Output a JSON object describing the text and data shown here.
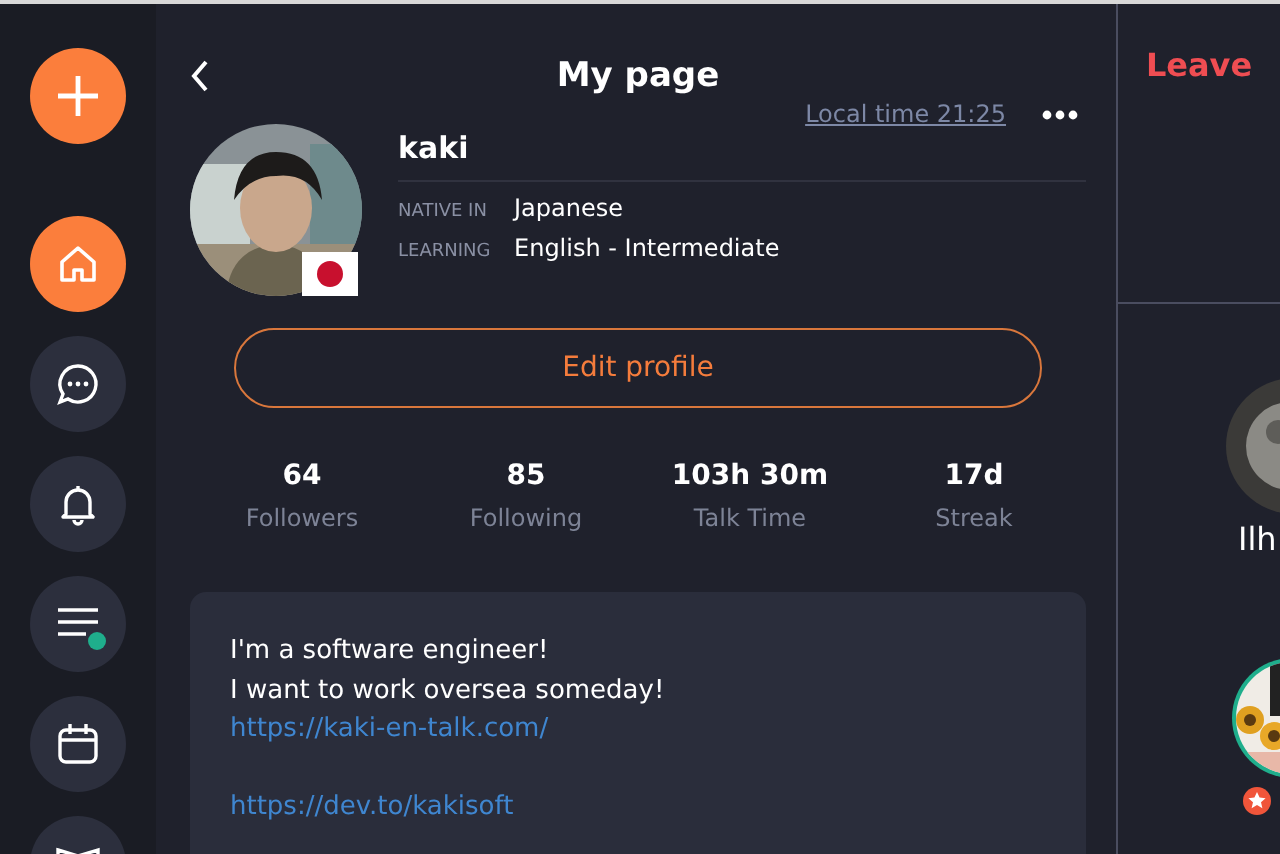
{
  "sidebar": {
    "items": [
      {
        "selected": true,
        "dot": false
      },
      {
        "selected": false,
        "dot": false
      },
      {
        "selected": false,
        "dot": false
      },
      {
        "selected": false,
        "dot": true
      },
      {
        "selected": false,
        "dot": false
      },
      {
        "selected": false
      }
    ]
  },
  "header": {
    "title": "My page",
    "local_time": "Local time 21:25"
  },
  "profile": {
    "name": "kaki",
    "languages": [
      {
        "label": "NATIVE IN",
        "value": "Japanese"
      },
      {
        "label": "LEARNING",
        "value": "English - Intermediate"
      }
    ],
    "edit_button": "Edit profile"
  },
  "stats": [
    {
      "value": "64",
      "label": "Followers"
    },
    {
      "value": "85",
      "label": "Following"
    },
    {
      "value": "103h 30m",
      "label": "Talk Time"
    },
    {
      "value": "17d",
      "label": "Streak"
    }
  ],
  "bio": {
    "lines": [
      {
        "kind": "text",
        "text": "I'm a software engineer!"
      },
      {
        "kind": "text",
        "text": "I want to work oversea someday!"
      },
      {
        "kind": "link",
        "text": "https://kaki-en-talk.com/"
      },
      {
        "kind": "gap"
      },
      {
        "kind": "link",
        "text": "https://dev.to/kakisoft"
      }
    ]
  },
  "side_panel": {
    "leave_button": "Leave",
    "users": [
      {
        "name": "Ilh",
        "starred": false
      },
      {
        "starred": true
      }
    ]
  }
}
